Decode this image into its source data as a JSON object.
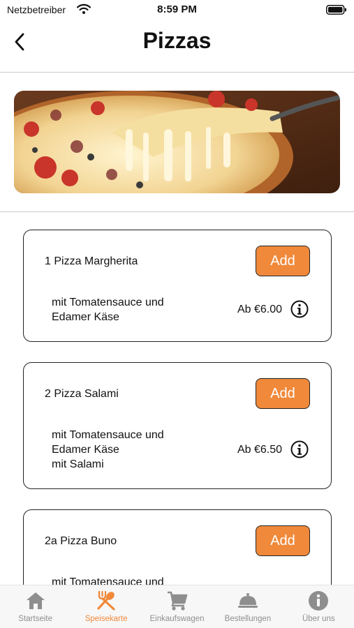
{
  "status_bar": {
    "carrier": "Netzbetreiber",
    "time": "8:59 PM"
  },
  "header": {
    "title": "Pizzas"
  },
  "menu_items": [
    {
      "name": "1 Pizza Margherita",
      "description_lines": [
        "mit Tomatensauce und",
        "Edamer Käse"
      ],
      "price": "Ab €6.00",
      "add_label": "Add"
    },
    {
      "name": "2 Pizza Salami",
      "description_lines": [
        "mit Tomatensauce und",
        "Edamer Käse",
        "mit Salami"
      ],
      "price": "Ab €6.50",
      "add_label": "Add"
    },
    {
      "name": "2a Pizza Buno",
      "description_lines": [
        "mit Tomatensauce und"
      ],
      "add_label": "Add"
    }
  ],
  "tab_bar": {
    "active_color": "#f0893a",
    "inactive_color": "#8e8e8e",
    "tabs": [
      {
        "label": "Startseite",
        "icon": "home-icon",
        "active": false
      },
      {
        "label": "Speisekarte",
        "icon": "fork-spoon-icon",
        "active": true
      },
      {
        "label": "Einkaufswagen",
        "icon": "cart-icon",
        "active": false
      },
      {
        "label": "Bestellungen",
        "icon": "cloche-icon",
        "active": false
      },
      {
        "label": "Über uns",
        "icon": "info-icon",
        "active": false
      }
    ]
  }
}
